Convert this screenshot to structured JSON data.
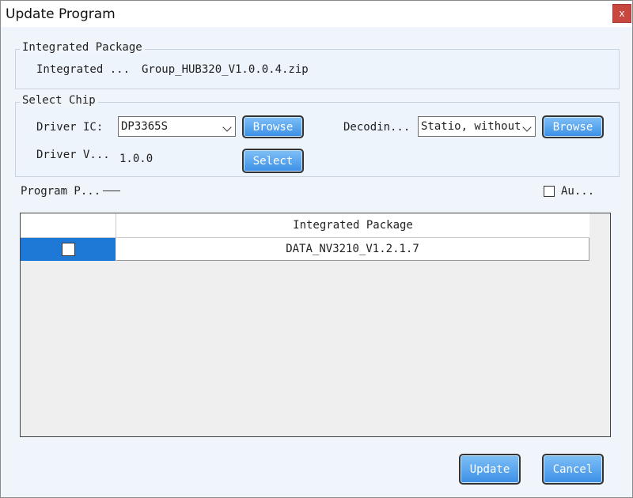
{
  "window": {
    "title": "Update Program",
    "close_label": "x"
  },
  "integrated_package": {
    "legend": "Integrated Package",
    "label": "Integrated ...",
    "value": "Group_HUB320_V1.0.0.4.zip"
  },
  "select_chip": {
    "legend": "Select Chip",
    "driver_ic_label": "Driver IC:",
    "driver_ic_value": "DP3365S",
    "browse_label": "Browse",
    "decoding_label": "Decodin...",
    "decoding_value": "Statio, without",
    "browse2_label": "Browse",
    "driver_version_label": "Driver V...",
    "driver_version_value": "1.0.0",
    "select_label": "Select"
  },
  "program": {
    "label": "Program P...",
    "auto_label": "Au...",
    "auto_checked": false
  },
  "table": {
    "column_header": "Integrated Package",
    "rows": [
      {
        "checked": false,
        "name": "DATA_NV3210_V1.2.1.7"
      }
    ]
  },
  "footer": {
    "update_label": "Update",
    "cancel_label": "Cancel"
  },
  "colors": {
    "accent": "#3b8fe6",
    "selection": "#1e78d6",
    "close": "#c8473e"
  }
}
